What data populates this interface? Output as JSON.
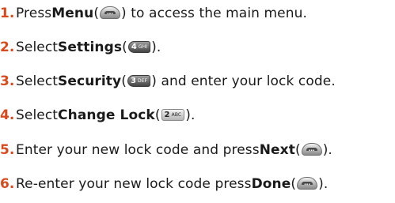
{
  "steps": [
    {
      "number": "1.",
      "before": "Press ",
      "bold": "Menu",
      "open": " (",
      "key": {
        "type": "softkey",
        "icon": "menu-softkey-icon",
        "glyph": "…"
      },
      "after": ") to access the main menu."
    },
    {
      "number": "2.",
      "before": "Select ",
      "bold": "Settings",
      "open": " (",
      "key": {
        "type": "numkey",
        "icon": "key-4-ghi-icon",
        "digit": "4",
        "letters": "GHI"
      },
      "after": ")."
    },
    {
      "number": "3.",
      "before": "Select ",
      "bold": "Security",
      "open": " (",
      "key": {
        "type": "numkey",
        "icon": "key-3-def-icon",
        "digit": "3",
        "letters": "DEF"
      },
      "after": ") and enter your lock code."
    },
    {
      "number": "4.",
      "before": "Select ",
      "bold": "Change Lock",
      "open": " (",
      "key": {
        "type": "numkey",
        "icon": "key-2-abc-icon",
        "digit": "2",
        "letters": "ABC"
      },
      "after": ")."
    },
    {
      "number": "5.",
      "before": "Enter your new lock code and press ",
      "bold": "Next",
      "open": " (",
      "key": {
        "type": "softkey",
        "icon": "next-softkey-icon",
        "glyph": "…"
      },
      "after": ")."
    },
    {
      "number": "6.",
      "before": "Re-enter your new lock code press ",
      "bold": "Done",
      "open": " (",
      "key": {
        "type": "softkey",
        "icon": "done-softkey-icon",
        "glyph": "…"
      },
      "after": ")."
    }
  ]
}
